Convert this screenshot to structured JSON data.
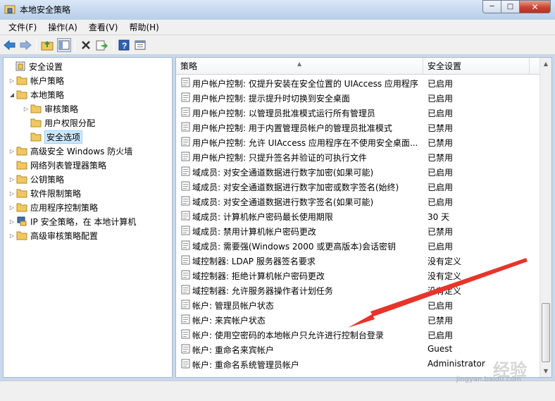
{
  "window": {
    "title": "本地安全策略",
    "minimize": "─",
    "maximize": "□",
    "close": "✕"
  },
  "menu": [
    "文件(F)",
    "操作(A)",
    "查看(V)",
    "帮助(H)"
  ],
  "toolbar": {
    "icons": [
      "back-arrow-icon",
      "forward-arrow-icon",
      "up-folder-icon",
      "show-tree-icon",
      "delete-icon",
      "export-icon",
      "help-icon",
      "properties-icon"
    ]
  },
  "tree": {
    "items": [
      {
        "label": "安全设置",
        "level": 0,
        "expander": ""
      },
      {
        "label": "帐户策略",
        "level": 1,
        "expander": "▷"
      },
      {
        "label": "本地策略",
        "level": 1,
        "expander": "◢"
      },
      {
        "label": "审核策略",
        "level": 2,
        "expander": "▷"
      },
      {
        "label": "用户权限分配",
        "level": 2,
        "expander": ""
      },
      {
        "label": "安全选项",
        "level": 2,
        "expander": "",
        "selected": true
      },
      {
        "label": "高级安全 Windows 防火墙",
        "level": 1,
        "expander": "▷"
      },
      {
        "label": "网络列表管理器策略",
        "level": 1,
        "expander": ""
      },
      {
        "label": "公钥策略",
        "level": 1,
        "expander": "▷"
      },
      {
        "label": "软件限制策略",
        "level": 1,
        "expander": "▷"
      },
      {
        "label": "应用程序控制策略",
        "level": 1,
        "expander": "▷"
      },
      {
        "label": "IP 安全策略，在 本地计算机",
        "level": 1,
        "expander": "▷"
      },
      {
        "label": "高级审核策略配置",
        "level": 1,
        "expander": "▷"
      }
    ]
  },
  "list": {
    "columns": {
      "policy": "策略",
      "setting": "安全设置"
    },
    "rows": [
      {
        "policy": "用户帐户控制: 仅提升安装在安全位置的 UIAccess 应用程序",
        "setting": "已启用"
      },
      {
        "policy": "用户帐户控制: 提示提升时切换到安全桌面",
        "setting": "已启用"
      },
      {
        "policy": "用户帐户控制: 以管理员批准模式运行所有管理员",
        "setting": "已启用"
      },
      {
        "policy": "用户帐户控制: 用于内置管理员帐户的管理员批准模式",
        "setting": "已禁用"
      },
      {
        "policy": "用户帐户控制: 允许 UIAccess 应用程序在不使用安全桌面...",
        "setting": "已禁用"
      },
      {
        "policy": "用户帐户控制: 只提升签名并验证的可执行文件",
        "setting": "已禁用"
      },
      {
        "policy": "域成员: 对安全通道数据进行数字加密(如果可能)",
        "setting": "已启用"
      },
      {
        "policy": "域成员: 对安全通道数据进行数字加密或数字签名(始终)",
        "setting": "已启用"
      },
      {
        "policy": "域成员: 对安全通道数据进行数字签名(如果可能)",
        "setting": "已启用"
      },
      {
        "policy": "域成员: 计算机帐户密码最长使用期限",
        "setting": "30 天"
      },
      {
        "policy": "域成员: 禁用计算机帐户密码更改",
        "setting": "已禁用"
      },
      {
        "policy": "域成员: 需要强(Windows 2000 或更高版本)会话密钥",
        "setting": "已启用"
      },
      {
        "policy": "域控制器: LDAP 服务器签名要求",
        "setting": "没有定义"
      },
      {
        "policy": "域控制器: 拒绝计算机帐户密码更改",
        "setting": "没有定义"
      },
      {
        "policy": "域控制器: 允许服务器操作者计划任务",
        "setting": "没有定义"
      },
      {
        "policy": "帐户: 管理员帐户状态",
        "setting": "已启用"
      },
      {
        "policy": "帐户: 来宾帐户状态",
        "setting": "已禁用"
      },
      {
        "policy": "帐户: 使用空密码的本地帐户只允许进行控制台登录",
        "setting": "已启用"
      },
      {
        "policy": "帐户: 重命名来宾帐户",
        "setting": "Guest"
      },
      {
        "policy": "帐户: 重命名系统管理员帐户",
        "setting": "Administrator"
      }
    ]
  },
  "watermark": {
    "text": "经验",
    "url": "jingyan.baidu.com"
  },
  "colors": {
    "annotation_arrow": "#e8342a",
    "selection": "#cce8ff",
    "folder": "#f0c860"
  }
}
